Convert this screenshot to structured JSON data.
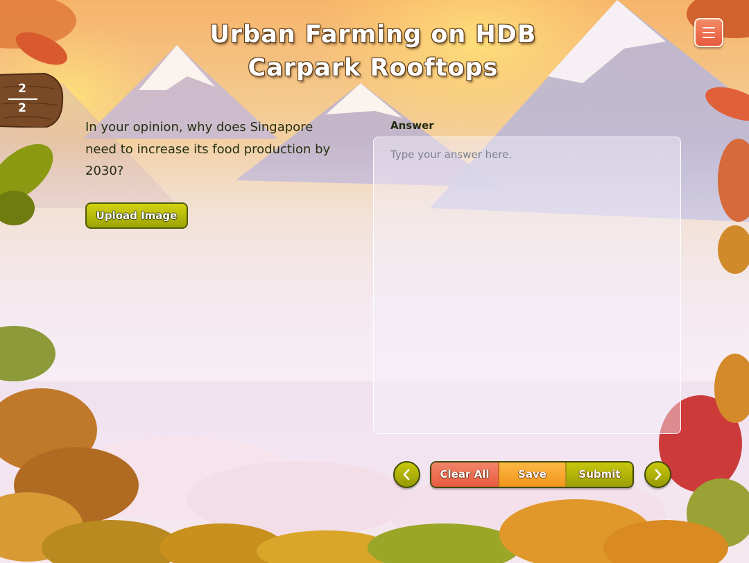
{
  "title": "Urban Farming on HDB Carpark Rooftops",
  "menu": {
    "icon": "hamburger-menu-icon"
  },
  "page": {
    "current": "2",
    "total": "2"
  },
  "question": {
    "text": "In your opinion, why does Singapore need to increase its food production by 2030?"
  },
  "upload": {
    "label": "Upload Image"
  },
  "answer": {
    "label": "Answer",
    "placeholder": "Type your answer here.",
    "value": ""
  },
  "nav": {
    "prev_icon": "chevron-left-icon",
    "next_icon": "chevron-right-icon"
  },
  "actions": {
    "clear_label": "Clear All",
    "save_label": "Save",
    "submit_label": "Submit"
  },
  "colors": {
    "accent_olive": "#a8ad08",
    "clear_red": "#ec6a4e",
    "save_orange": "#f7a830",
    "menu_red": "#e8603f"
  }
}
